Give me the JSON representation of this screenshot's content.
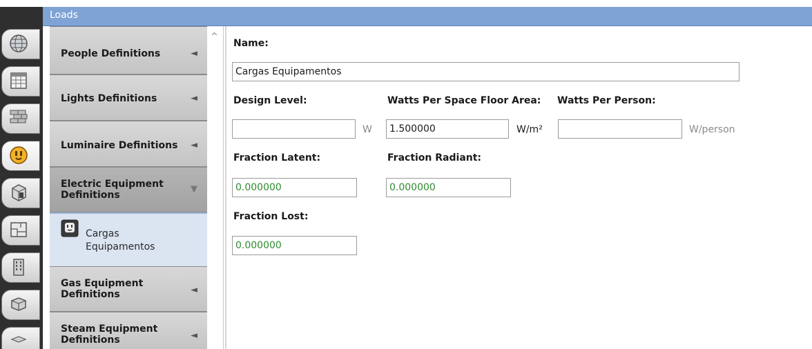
{
  "header": {
    "title": "Loads"
  },
  "navtabs": [
    {
      "name": "site-globe-icon"
    },
    {
      "name": "schedules-calendar-icon"
    },
    {
      "name": "constructions-bricks-icon"
    },
    {
      "name": "loads-outlet-icon",
      "active": true
    },
    {
      "name": "space-types-cube-icon"
    },
    {
      "name": "geometry-floorplan-icon"
    },
    {
      "name": "facility-building-icon"
    },
    {
      "name": "spaces-box-icon"
    },
    {
      "name": "thermal-zones-icon"
    }
  ],
  "definitions": [
    {
      "label": "People Definitions",
      "arrow": "◄"
    },
    {
      "label": "Lights Definitions",
      "arrow": "◄"
    },
    {
      "label": "Luminaire Definitions",
      "arrow": "◄"
    },
    {
      "label": "Electric Equipment Definitions",
      "arrow": "▼"
    },
    {
      "label": "Gas Equipment Definitions",
      "arrow": "◄"
    },
    {
      "label": "Steam Equipment Definitions",
      "arrow": "◄"
    }
  ],
  "selected_item": {
    "label": "Cargas Equipamentos",
    "icon": "electric-outlet-icon"
  },
  "scroll": {
    "up_arrow": "^"
  },
  "form": {
    "name_label": "Name:",
    "name_value": "Cargas Equipamentos",
    "design_level_label": "Design Level:",
    "design_level_value": "",
    "design_level_unit": "W",
    "watts_area_label": "Watts Per Space Floor Area:",
    "watts_area_value": "1.500000",
    "watts_area_unit": "W/m²",
    "watts_person_label": "Watts Per Person:",
    "watts_person_value": "",
    "watts_person_unit": "W/person",
    "fraction_latent_label": "Fraction Latent:",
    "fraction_latent_value": "0.000000",
    "fraction_radiant_label": "Fraction Radiant:",
    "fraction_radiant_value": "0.000000",
    "fraction_lost_label": "Fraction Lost:",
    "fraction_lost_value": "0.000000"
  },
  "colors": {
    "header": "#7ea3d4",
    "selected": "#dbe4f1",
    "default_value_green": "#2e8b2e"
  }
}
